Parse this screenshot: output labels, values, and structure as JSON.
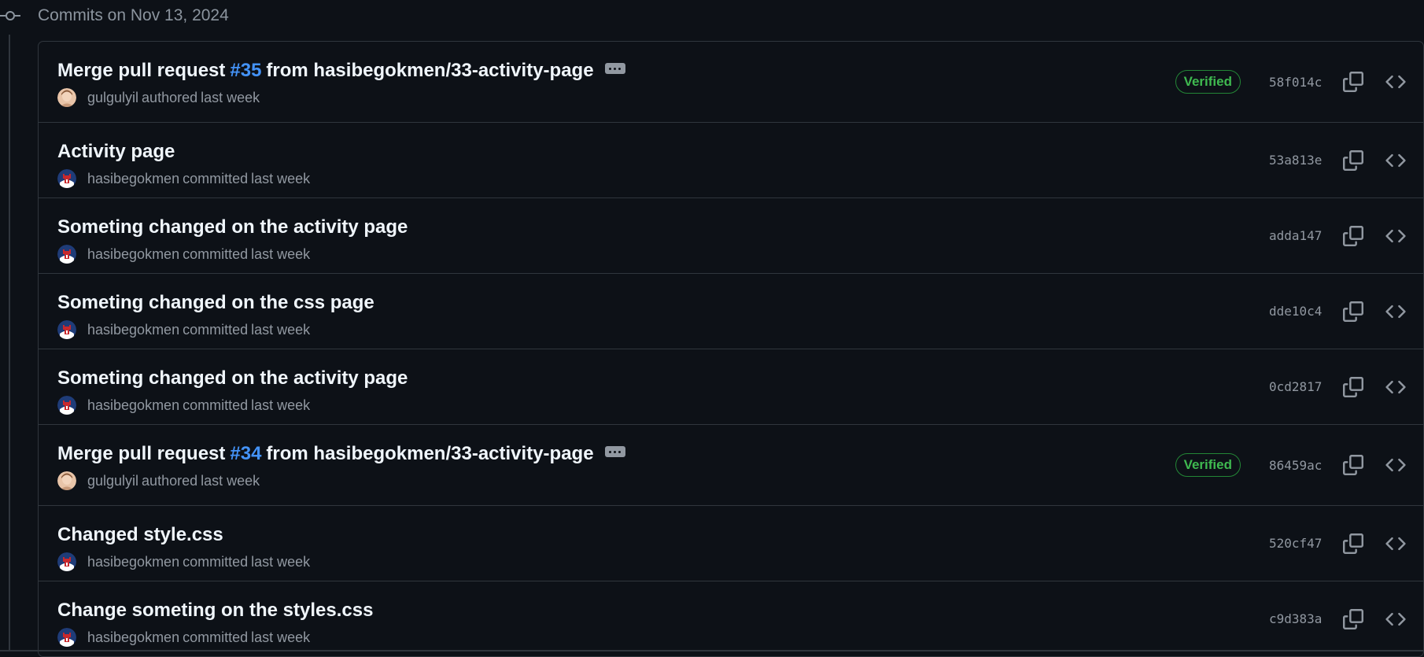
{
  "header": {
    "date_label": "Commits on Nov 13, 2024"
  },
  "commits": [
    {
      "title_prefix": "Merge pull request ",
      "pr_ref": "#35",
      "title_suffix": " from hasibegokmen/33-activity-page",
      "author": "gulgulyil",
      "action": "authored",
      "time": "last week",
      "verified": "Verified",
      "sha": "58f014c",
      "avatar": "gulgulyil-avatar"
    },
    {
      "title": "Activity page",
      "author": "hasibegokmen",
      "action": "committed",
      "time": "last week",
      "sha": "53a813e",
      "avatar": "hasibegokmen-avatar"
    },
    {
      "title": "Someting changed on the activity page",
      "author": "hasibegokmen",
      "action": "committed",
      "time": "last week",
      "sha": "adda147",
      "avatar": "hasibegokmen-avatar"
    },
    {
      "title": "Someting changed on the css page",
      "author": "hasibegokmen",
      "action": "committed",
      "time": "last week",
      "sha": "dde10c4",
      "avatar": "hasibegokmen-avatar"
    },
    {
      "title": "Someting changed on the activity page",
      "author": "hasibegokmen",
      "action": "committed",
      "time": "last week",
      "sha": "0cd2817",
      "avatar": "hasibegokmen-avatar"
    },
    {
      "title_prefix": "Merge pull request ",
      "pr_ref": "#34",
      "title_suffix": " from hasibegokmen/33-activity-page",
      "author": "gulgulyil",
      "action": "authored",
      "time": "last week",
      "verified": "Verified",
      "sha": "86459ac",
      "avatar": "gulgulyil-avatar"
    },
    {
      "title": "Changed style.css",
      "author": "hasibegokmen",
      "action": "committed",
      "time": "last week",
      "sha": "520cf47",
      "avatar": "hasibegokmen-avatar"
    },
    {
      "title": "Change someting on the styles.css",
      "author": "hasibegokmen",
      "action": "committed",
      "time": "last week",
      "sha": "c9d383a",
      "avatar": "hasibegokmen-avatar"
    }
  ],
  "icons": {
    "timeline": "git-commit-icon",
    "copy": "copy-icon",
    "browse": "code-icon",
    "more": "ellipsis-icon"
  },
  "colors": {
    "background": "#0d1117",
    "border": "#30363d",
    "link": "#4493f8",
    "verified": "#3fb950",
    "muted": "#9198a1"
  }
}
